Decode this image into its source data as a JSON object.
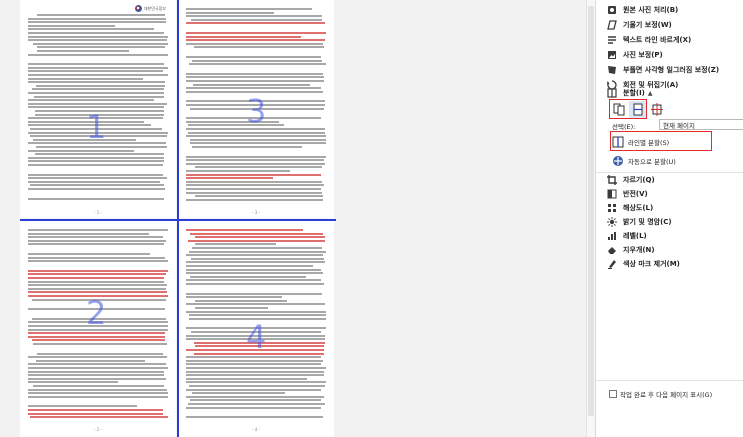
{
  "canvas": {
    "page_numbers": [
      "- 1 -",
      "- 2 -",
      "- 3 -",
      "- 4 -"
    ],
    "region_numbers": [
      "1",
      "2",
      "3",
      "4"
    ],
    "logo_text": "대한민국정부"
  },
  "panel": {
    "menu": [
      {
        "label": "원본 사진 처리(B)",
        "icon": "photo-icon"
      },
      {
        "label": "기울기 보정(W)",
        "icon": "skew-icon"
      },
      {
        "label": "텍스트 라인 바르게(X)",
        "icon": "text-line-icon"
      },
      {
        "label": "사진 보정(P)",
        "icon": "photo-adjust-icon"
      },
      {
        "label": "부플면 사각형 일그러짐 보정(Z)",
        "icon": "distortion-icon"
      },
      {
        "label": "회전 및 뒤집기(A)",
        "icon": "rotate-icon"
      },
      {
        "label": "분할(I)",
        "icon": "split-icon",
        "expanded": true
      }
    ],
    "split": {
      "select_label": "선택(E):",
      "select_value": "현재 페이지",
      "actions": [
        {
          "label": "라인별 분할(S)",
          "icon": "line-split-icon"
        },
        {
          "label": "자동으로 분할(U)",
          "icon": "auto-split-icon"
        }
      ]
    },
    "menu2": [
      {
        "label": "자르기(Q)",
        "icon": "crop-icon"
      },
      {
        "label": "반전(V)",
        "icon": "invert-icon"
      },
      {
        "label": "해상도(L)",
        "icon": "resolution-icon"
      },
      {
        "label": "밝기 및 명암(C)",
        "icon": "brightness-icon"
      },
      {
        "label": "레벨(L)",
        "icon": "levels-icon"
      },
      {
        "label": "지우개(N)",
        "icon": "eraser-icon"
      },
      {
        "label": "색상 마크 제거(M)",
        "icon": "color-mark-icon"
      }
    ],
    "footer_checkbox": "작업 완료 후 다음 페이지 표시(G)"
  },
  "colors": {
    "split_line": "#2b3fd8",
    "highlight": "#e42a2a",
    "region_number": "#3f52e3"
  }
}
